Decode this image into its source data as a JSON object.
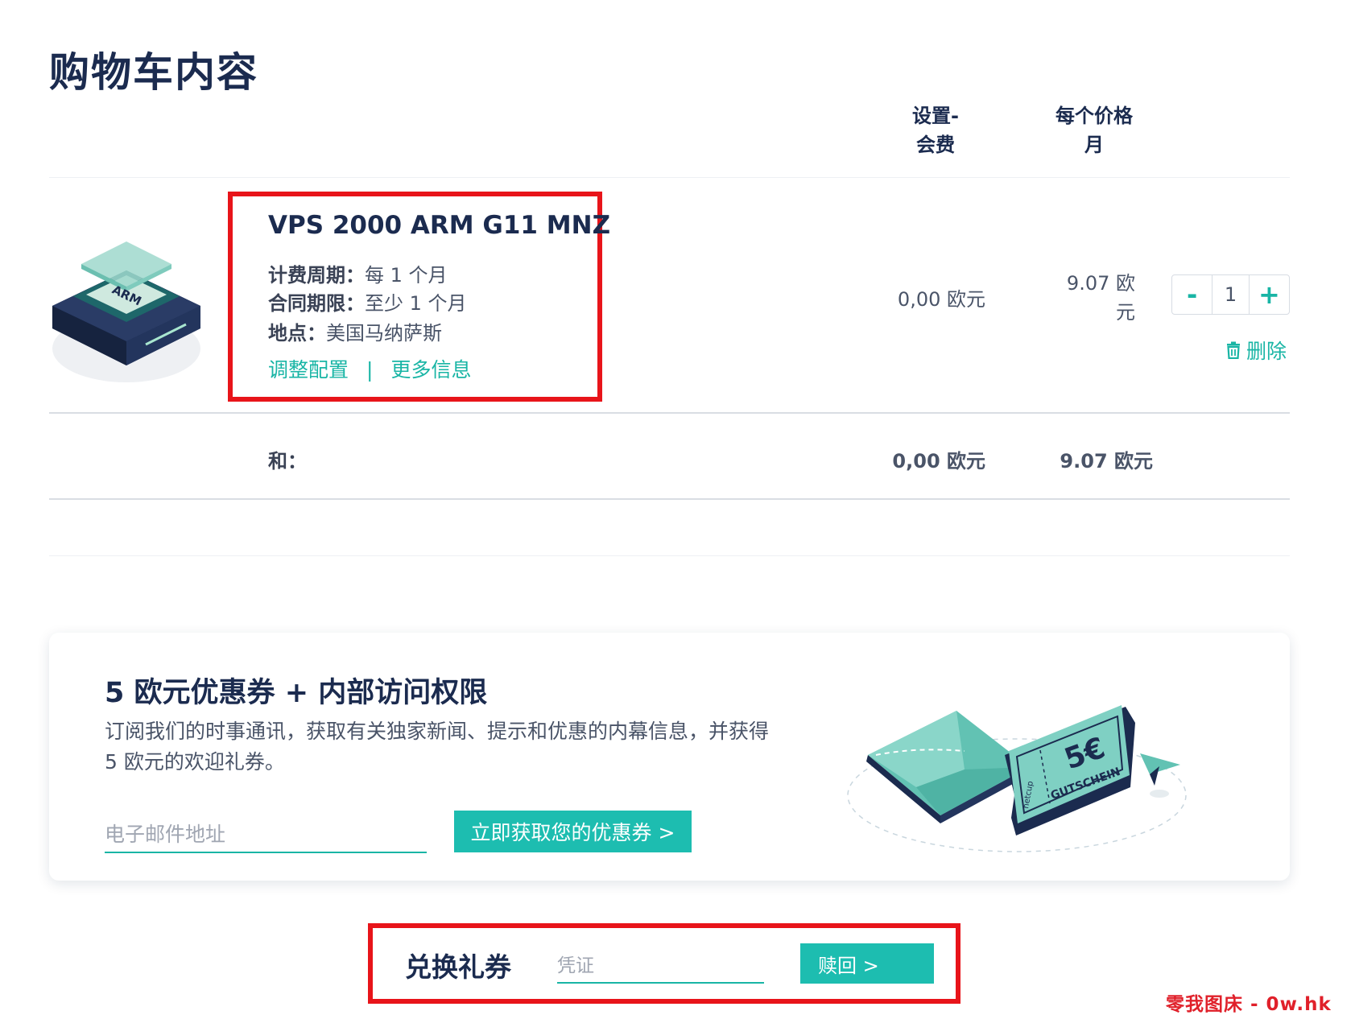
{
  "page": {
    "title": "购物车内容"
  },
  "columns": {
    "setup_fee": "设置-\n会费",
    "setup_line1": "设置-",
    "setup_line2": "会费",
    "price_line1": "每个价格",
    "price_line2": "月"
  },
  "product": {
    "name": "VPS 2000 ARM G11 MNZ",
    "image_label": "ARM",
    "billing_label": "计费周期：",
    "billing_value": "每 1 个月",
    "contract_label": "合同期限：",
    "contract_value": "至少 1 个月",
    "location_label": "地点：",
    "location_value": "美国马纳萨斯",
    "link_configure": "调整配置",
    "link_separator": "|",
    "link_more": "更多信息",
    "setup_fee": "0,00 欧元",
    "price_line1": "9.07 欧",
    "price_line2": "元",
    "quantity": "1",
    "qty_minus": "-",
    "qty_plus": "+",
    "delete_label": "删除"
  },
  "summary": {
    "label": "和：",
    "setup_total": "0,00 欧元",
    "price_total": "9.07 欧元"
  },
  "promo": {
    "title": "5 欧元优惠券 + 内部访问权限",
    "description": "订阅我们的时事通讯，获取有关独家新闻、提示和优惠的内幕信息，并获得 5 欧元的欢迎礼券。",
    "email_placeholder": "电子邮件地址",
    "button_label": "立即获取您的优惠券 >",
    "illustration_amount": "5€",
    "illustration_text": "GUTSCHEIN",
    "illustration_brand": "netcup"
  },
  "voucher": {
    "label": "兑换礼券",
    "placeholder": "凭证",
    "button_label": "赎回 >"
  },
  "watermark": "零我图床 - 0w.hk",
  "colors": {
    "accent": "#1dbdb0",
    "navy": "#1b2b4f",
    "highlight": "#e8141a"
  }
}
